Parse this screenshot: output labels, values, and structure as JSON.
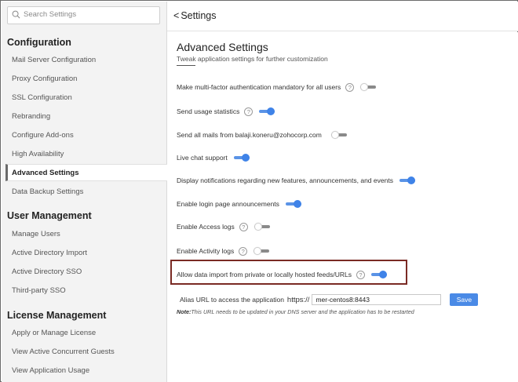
{
  "search": {
    "placeholder": "Search Settings"
  },
  "sidebar": {
    "sections": [
      {
        "title": "Configuration",
        "items": [
          {
            "label": "Mail Server Configuration",
            "active": false
          },
          {
            "label": "Proxy Configuration",
            "active": false
          },
          {
            "label": "SSL Configuration",
            "active": false
          },
          {
            "label": "Rebranding",
            "active": false
          },
          {
            "label": "Configure Add-ons",
            "active": false
          },
          {
            "label": "High Availability",
            "active": false
          },
          {
            "label": "Advanced Settings",
            "active": true
          },
          {
            "label": "Data Backup Settings",
            "active": false
          }
        ]
      },
      {
        "title": "User Management",
        "items": [
          {
            "label": "Manage Users",
            "active": false
          },
          {
            "label": "Active Directory Import",
            "active": false
          },
          {
            "label": "Active Directory SSO",
            "active": false
          },
          {
            "label": "Third-party SSO",
            "active": false
          }
        ]
      },
      {
        "title": "License Management",
        "items": [
          {
            "label": "Apply or Manage License",
            "active": false
          },
          {
            "label": "View Active Concurrent Guests",
            "active": false
          },
          {
            "label": "View Application Usage",
            "active": false
          }
        ]
      }
    ]
  },
  "header": {
    "back_label": "Settings"
  },
  "main": {
    "title": "Advanced Settings",
    "subtitle": "Tweak application settings for further customization",
    "settings": [
      {
        "label": "Make multi-factor authentication mandatory for all users",
        "help": true,
        "enabled": false
      },
      {
        "label": "Send usage statistics",
        "help": true,
        "enabled": true
      },
      {
        "label": "Send all mails from balaji.koneru@zohocorp.com",
        "help": false,
        "enabled": false
      },
      {
        "label": "Live chat support",
        "help": false,
        "enabled": true
      },
      {
        "label": "Display notifications regarding new features, announcements, and events",
        "help": false,
        "enabled": true
      },
      {
        "label": "Enable login page announcements",
        "help": false,
        "enabled": true
      },
      {
        "label": "Enable Access logs",
        "help": true,
        "enabled": false
      },
      {
        "label": "Enable Activity logs",
        "help": true,
        "enabled": false
      },
      {
        "label": "Allow data import from private or locally hosted feeds/URLs",
        "help": true,
        "enabled": true
      }
    ],
    "alias": {
      "label": "Alias URL to access the application",
      "prefix": "https://",
      "value": "mer-centos8:8443",
      "save_label": "Save",
      "note_bold": "Note:",
      "note_text": "This URL needs to be updated in your DNS server and the application has to be restarted"
    }
  },
  "colors": {
    "accent": "#3f83e8",
    "highlight_border": "#7a2a24",
    "sidebar_bg": "#f3f3f3"
  }
}
